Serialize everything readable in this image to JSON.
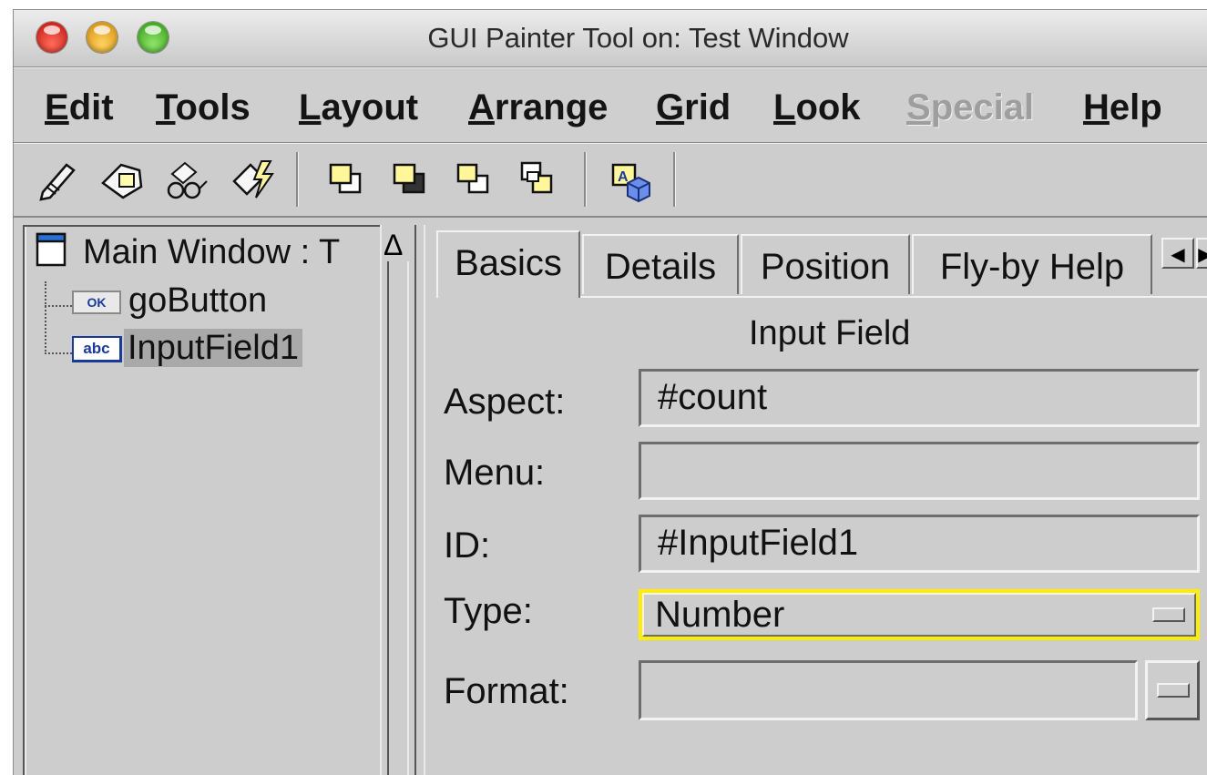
{
  "window": {
    "title": "GUI Painter Tool on: Test Window"
  },
  "menubar": {
    "items": [
      {
        "mnemonic": "E",
        "rest": "dit"
      },
      {
        "mnemonic": "T",
        "rest": "ools"
      },
      {
        "mnemonic": "L",
        "rest": "ayout"
      },
      {
        "mnemonic": "A",
        "rest": "rrange"
      },
      {
        "mnemonic": "G",
        "rest": "rid"
      },
      {
        "mnemonic": "L",
        "rest": "ook"
      },
      {
        "mnemonic": "S",
        "rest": "pecial"
      },
      {
        "mnemonic": "H",
        "rest": "elp"
      }
    ]
  },
  "toolbar": {
    "icons": [
      "install-icon",
      "define-icon",
      "browse-icon",
      "test-icon",
      "bring-forward-icon",
      "send-backward-icon",
      "bring-to-front-icon",
      "send-to-back-icon",
      "resources-icon"
    ]
  },
  "tree": {
    "root": {
      "icon": "window-icon",
      "label": "Main Window : T"
    },
    "children": [
      {
        "icon_text": "OK",
        "label": "goButton"
      },
      {
        "icon_text": "abc",
        "label": "InputField1"
      }
    ]
  },
  "tabs": [
    {
      "label": "Basics"
    },
    {
      "label": "Details"
    },
    {
      "label": "Position"
    },
    {
      "label": "Fly-by Help"
    }
  ],
  "properties": {
    "section_title": "Input Field",
    "aspect": {
      "label": "Aspect:",
      "value": "#count"
    },
    "menu": {
      "label": "Menu:",
      "value": ""
    },
    "id": {
      "label": "ID:",
      "value": "#InputField1"
    },
    "type": {
      "label": "Type:",
      "value": "Number"
    },
    "format": {
      "label": "Format:",
      "value": ""
    }
  },
  "colors": {
    "focus_highlight": "#ffee00",
    "selection": "#a9a9a9",
    "background": "#cdcdcd"
  }
}
